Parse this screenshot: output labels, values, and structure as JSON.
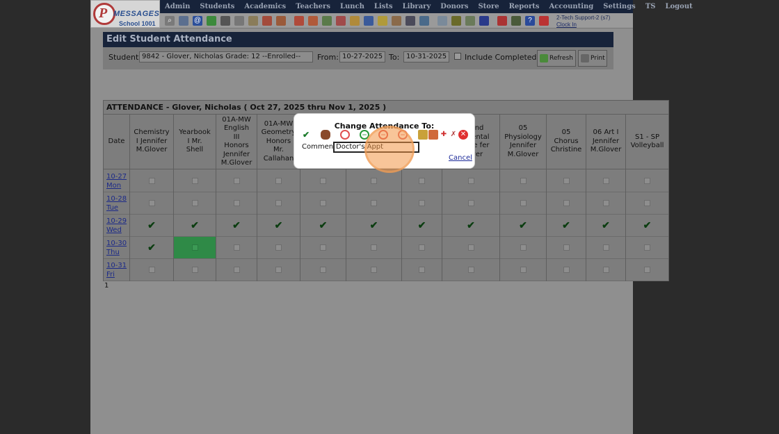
{
  "header": {
    "logo_brand": "MESSAGES",
    "logo_school": "School 1001",
    "menu": [
      "Admin",
      "Students",
      "Academics",
      "Teachers",
      "Lunch",
      "Lists",
      "Library",
      "Donors",
      "Store",
      "Reports",
      "Accounting",
      "Settings",
      "TS",
      "Logout"
    ],
    "user": "2-Tech Support-2 (s7)",
    "clock_in": "Clock In"
  },
  "edit": {
    "title": "Edit Student Attendance",
    "student_label": "Student:",
    "student_value": "9842 - Glover, Nicholas Grade: 12 --Enrolled--",
    "from_label": "From:",
    "from_value": "10-27-2025",
    "to_label": "To:",
    "to_value": "10-31-2025",
    "include_completed": "Include Completed",
    "refresh": "Refresh",
    "print": "Print"
  },
  "attendance": {
    "header": "ATTENDANCE - Glover, Nicholas   ( Oct 27, 2025 thru Nov 1, 2025 )",
    "date_col": "Date",
    "dates": [
      {
        "date": "10-27",
        "day": "Mon"
      },
      {
        "date": "10-28",
        "day": "Tue"
      },
      {
        "date": "10-29",
        "day": "Wed"
      },
      {
        "date": "10-30",
        "day": "Thu"
      },
      {
        "date": "10-31",
        "day": "Fri"
      }
    ],
    "columns": [
      "Chemistry I Jennifer M.Glover",
      "Yearbook I Mr. Shell",
      "01A-MW English III Honors Jennifer M.Glover",
      "01A-MW Geometry Honors Mr. Callahan",
      "",
      "",
      "",
      "and mental nce fer ver",
      "05 Physiology Jennifer M.Glover",
      "05 Chorus Christine",
      "06 Art I Jennifer M.Glover",
      "S1 - SP Volleyball"
    ],
    "present_mark": "✔",
    "page": "1"
  },
  "modal": {
    "title": "Change Attendance To:",
    "comment_label": "Comment",
    "comment_value": "Doctor's Appt",
    "cancel": "Cancel"
  },
  "colors": {
    "menubar": "#17233a",
    "present": "#0b3d10",
    "selected_cell": "#2f8a47",
    "highlight": "#f39646"
  }
}
